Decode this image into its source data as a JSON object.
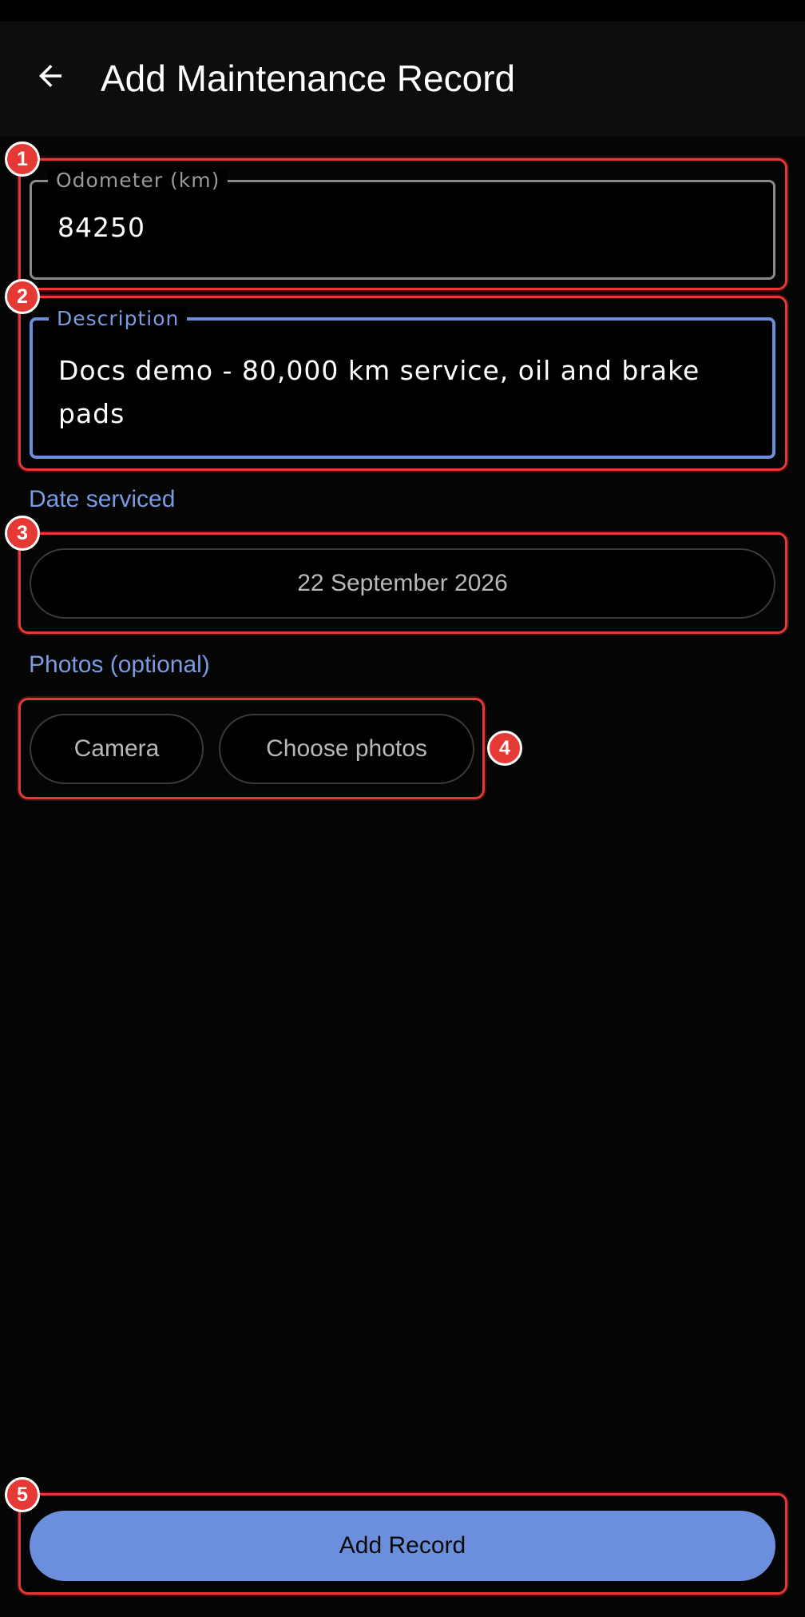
{
  "header": {
    "back_icon": "arrow-left-icon",
    "title": "Add Maintenance Record"
  },
  "form": {
    "odometer": {
      "label": "Odometer (km)",
      "value": "84250"
    },
    "description": {
      "label": "Description",
      "value": "Docs demo - 80,000 km service, oil and brake pads"
    },
    "date_serviced": {
      "label": "Date serviced",
      "value": "22 September 2026"
    },
    "photos": {
      "label": "Photos (optional)",
      "camera_label": "Camera",
      "choose_label": "Choose photos"
    },
    "submit_label": "Add Record"
  },
  "annotations": [
    "1",
    "2",
    "3",
    "4",
    "5"
  ],
  "colors": {
    "accent": "#6b8fdc",
    "annotation": "#e53935",
    "background": "#050505"
  }
}
